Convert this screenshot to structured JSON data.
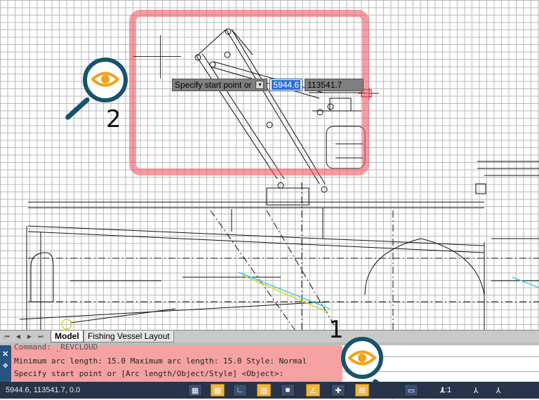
{
  "dynamic_input": {
    "prompt": "Specify start point or",
    "value_x": "5944.6",
    "value_y": "113541.7"
  },
  "callouts": {
    "one": "1",
    "two": "2"
  },
  "tabs": {
    "model": "Model",
    "layout": "Fishing Vessel Layout"
  },
  "command": {
    "line1": "Command: _REVCLOUD",
    "line2": "Minimum arc length: 15.0 Maximum arc length: 15.0 Style: Normal",
    "line3": "Specify start point or [Arc length/Object/Style] <Object>:"
  },
  "status": {
    "coords": "5944.6, 113541.7, 0.0",
    "scale": "1:1"
  },
  "colors": {
    "highlight": "#f05a64",
    "magnifier": "#16536c",
    "eye": "#f3a21a",
    "statusbar": "#28344a",
    "grid": "#b9b9b9"
  },
  "icons": [
    "eye-icon",
    "magnifier-icon",
    "grid-icon",
    "snap-icon",
    "ortho-icon",
    "polar-icon",
    "osnap-icon",
    "otrack-icon",
    "lineweight-icon",
    "annotation-scale-icon"
  ]
}
